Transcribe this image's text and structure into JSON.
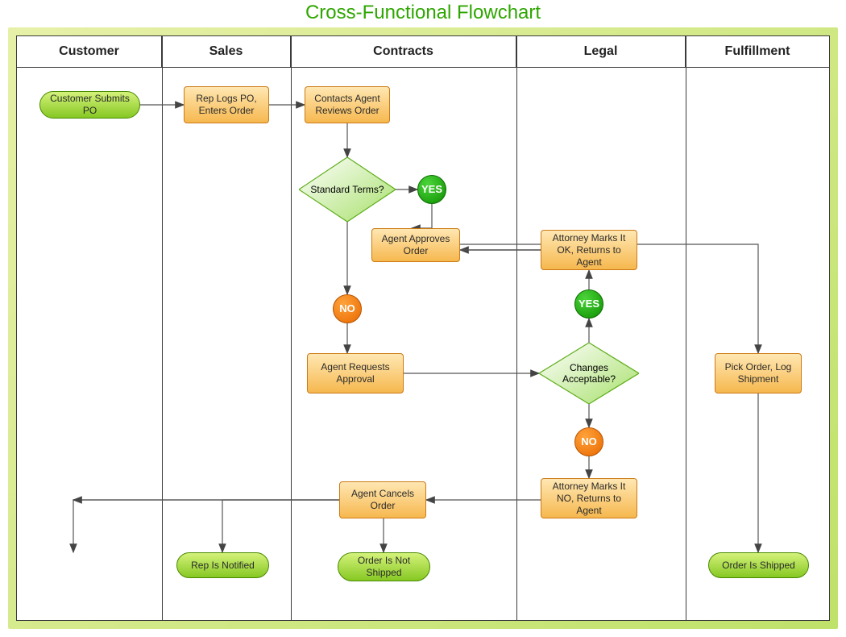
{
  "title": "Cross-Functional Flowchart",
  "lanes": {
    "customer": "Customer",
    "sales": "Sales",
    "contracts": "Contracts",
    "legal": "Legal",
    "fulfillment": "Fulfillment"
  },
  "nodes": {
    "customer_submits_po": "Customer Submits\nPO",
    "rep_logs_po": "Rep Logs PO,\nEnters Order",
    "contacts_agent_reviews": "Contacts Agent\nReviews Order",
    "standard_terms": "Standard Terms?",
    "yes1": "YES",
    "agent_approves": "Agent Approves\nOrder",
    "no1": "NO",
    "agent_requests_approval": "Agent Requests\nApproval",
    "changes_acceptable": "Changes\nAcceptable?",
    "yes2": "YES",
    "attorney_ok": "Attorney\nMarks It OK,\nReturns to Agent",
    "no2": "NO",
    "attorney_no": "Attorney\nMarks It NO,\nReturns to Agent",
    "agent_cancels": "Agent Cancels\nOrder",
    "rep_notified": "Rep Is Notified",
    "order_not_shipped": "Order Is\nNot Shipped",
    "pick_order": "Pick Order,\nLog Shipment",
    "order_shipped": "Order Is Shipped"
  }
}
